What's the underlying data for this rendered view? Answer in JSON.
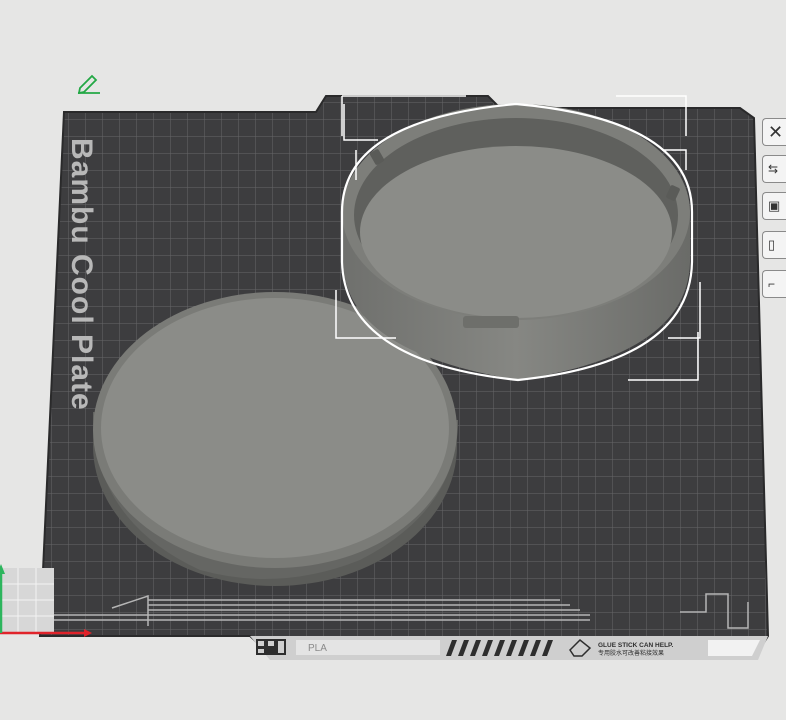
{
  "plate": {
    "brand_text": "Bambu Cool Plate",
    "filament_label": "PLA",
    "glue_notice_line1": "GLUE STICK CAN HELP.",
    "glue_notice_line2": "专用胶水可改善粘接效果"
  },
  "objects": [
    {
      "name": "round-lid",
      "selected": false
    },
    {
      "name": "round-cup-base",
      "selected": true
    }
  ],
  "toolbar": {
    "buttons": [
      {
        "name": "close",
        "icon": "close-x-icon"
      },
      {
        "name": "auto-arrange",
        "icon": "auto-arrange-icon"
      },
      {
        "name": "orient",
        "icon": "orient-icon"
      },
      {
        "name": "plate-settings",
        "icon": "plate-settings-icon"
      },
      {
        "name": "lock",
        "icon": "lock-icon"
      }
    ]
  },
  "colors": {
    "background": "#e6e6e5",
    "plate": "#3d3d3f",
    "plate_grid": "#6e6e70",
    "model": "#8b8c88",
    "selection": "#ffffff",
    "axis_x": "#e0232a",
    "axis_y": "#2db55d",
    "edit_icon": "#23a845"
  }
}
